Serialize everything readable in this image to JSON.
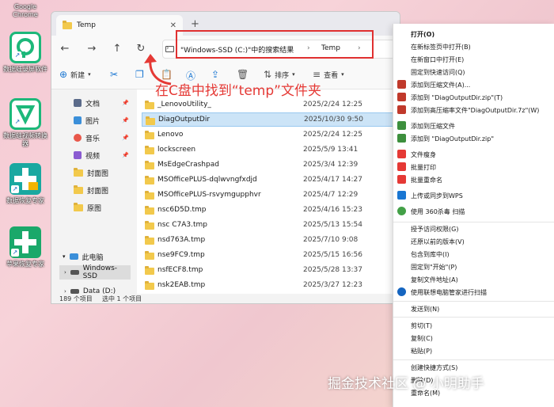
{
  "desktop": {
    "icons": [
      {
        "label": "Google\nChrome"
      },
      {
        "label": "数据蛙录屏软件"
      },
      {
        "label": "数据蛙视频转换器"
      },
      {
        "label": "数据恢复专家"
      },
      {
        "label": "苹果恢复专家"
      }
    ]
  },
  "explorer": {
    "tab_title": "Temp",
    "address": {
      "segment1": "\"Windows-SSD (C:)\"中的搜索结果",
      "segment2": "Temp"
    },
    "toolbar": {
      "new_label": "新建",
      "sort_label": "排序",
      "view_label": "查看"
    },
    "sidebar": {
      "items": [
        {
          "label": "文档"
        },
        {
          "label": "图片"
        },
        {
          "label": "音乐"
        },
        {
          "label": "视频"
        },
        {
          "label": "封面图"
        },
        {
          "label": "封面图"
        },
        {
          "label": "原图"
        },
        {
          "label": "此电脑"
        },
        {
          "label": "Windows-SSD"
        },
        {
          "label": "Data (D:)"
        }
      ]
    },
    "files": [
      {
        "name": "_LenovoUtility_",
        "date": "2025/2/24 12:25"
      },
      {
        "name": "DiagOutputDir",
        "date": "2025/10/30 9:50"
      },
      {
        "name": "Lenovo",
        "date": "2025/2/24 12:25"
      },
      {
        "name": "lockscreen",
        "date": "2025/5/9 13:41"
      },
      {
        "name": "MsEdgeCrashpad",
        "date": "2025/3/4 12:39"
      },
      {
        "name": "MSOfficePLUS-dqlwvngfxdjd",
        "date": "2025/4/17 14:27"
      },
      {
        "name": "MSOfficePLUS-rsvymgupphvr",
        "date": "2025/4/7 12:29"
      },
      {
        "name": "nsc6D5D.tmp",
        "date": "2025/4/16 15:23"
      },
      {
        "name": "nsc C7A3.tmp",
        "date": "2025/5/13 15:54"
      },
      {
        "name": "nsd763A.tmp",
        "date": "2025/7/10 9:08"
      },
      {
        "name": "nse9FC9.tmp",
        "date": "2025/5/15 16:56"
      },
      {
        "name": "nsfECF8.tmp",
        "date": "2025/5/28 13:37"
      },
      {
        "name": "nsk2EAB.tmp",
        "date": "2025/3/27 12:23"
      }
    ],
    "status": {
      "count": "189 个项目",
      "selected": "选中 1 个项目"
    }
  },
  "annotation": "在C盘中找到“temp”文件夹",
  "context_menu": {
    "items": [
      "打开(O)",
      "在新标签页中打开(B)",
      "在新窗口中打开(E)",
      "固定到快速访问(Q)",
      "添加到压缩文件(A)...",
      "添加到 \"DiagOutputDir.zip\"(T)",
      "添加到高压缩率文件\"DiagOutputDir.7z\"(W)",
      "添加到压缩文件",
      "添加到 \"DiagOutputDir.zip\"",
      "文件瘦身",
      "批量打印",
      "批量重命名",
      "上传或同步到WPS",
      "使用 360杀毒 扫描",
      "授予访问权限(G)",
      "还原以前的版本(V)",
      "包含到库中(I)",
      "固定到\"开始\"(P)",
      "复制文件地址(A)",
      "使用联想电脑管家进行扫描",
      "发送到(N)",
      "剪切(T)",
      "复制(C)",
      "粘贴(P)",
      "创建快捷方式(S)",
      "删除(D)",
      "重命名(M)"
    ]
  },
  "watermark": "掘金技术社区 @ 小明助手",
  "colors": {
    "accent": "#1976d2",
    "annotation_red": "#e53935",
    "folder_yellow": "#f2c94c",
    "selection": "#cce4f7"
  }
}
